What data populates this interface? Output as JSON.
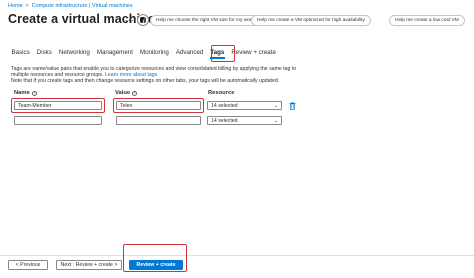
{
  "breadcrumb": {
    "items": [
      "Home",
      "Compute infrastructure | Virtual machines"
    ],
    "separator": ">"
  },
  "page": {
    "title": "Create a virtual machine",
    "more_label": "..."
  },
  "copilot_suggestions": [
    "Help me choose the right VM size for my workload",
    "Help me create a VM optimized for high availability",
    "Help me create a low cost VM"
  ],
  "tabs": [
    {
      "label": "Basics",
      "active": false
    },
    {
      "label": "Disks",
      "active": false
    },
    {
      "label": "Networking",
      "active": false
    },
    {
      "label": "Management",
      "active": false
    },
    {
      "label": "Monitoring",
      "active": false
    },
    {
      "label": "Advanced",
      "active": false
    },
    {
      "label": "Tags",
      "active": true
    },
    {
      "label": "Review + create",
      "active": false
    }
  ],
  "description": {
    "line1": "Tags are name/value pairs that enable you to categorize resources and view consolidated billing by applying the same tag to",
    "line2": "multiple resources and resource groups.",
    "link": "Learn more about tags",
    "line3": "Note that if you create tags and then change resource settings on other tabs, your tags will be automatically updated."
  },
  "tag_table": {
    "headers": {
      "name": "Name",
      "value": "Value",
      "resource": "Resource"
    },
    "rows": [
      {
        "name": "Team-Member",
        "value": "Teleo",
        "resource": "14 selected"
      },
      {
        "name": "",
        "value": "",
        "resource": "14 selected"
      }
    ]
  },
  "footer": {
    "previous_label": "< Previous",
    "next_label": "Next : Review + create >",
    "review_create_label": "Review + create"
  },
  "colors": {
    "accent": "#0078d4",
    "highlight": "#d13438"
  }
}
